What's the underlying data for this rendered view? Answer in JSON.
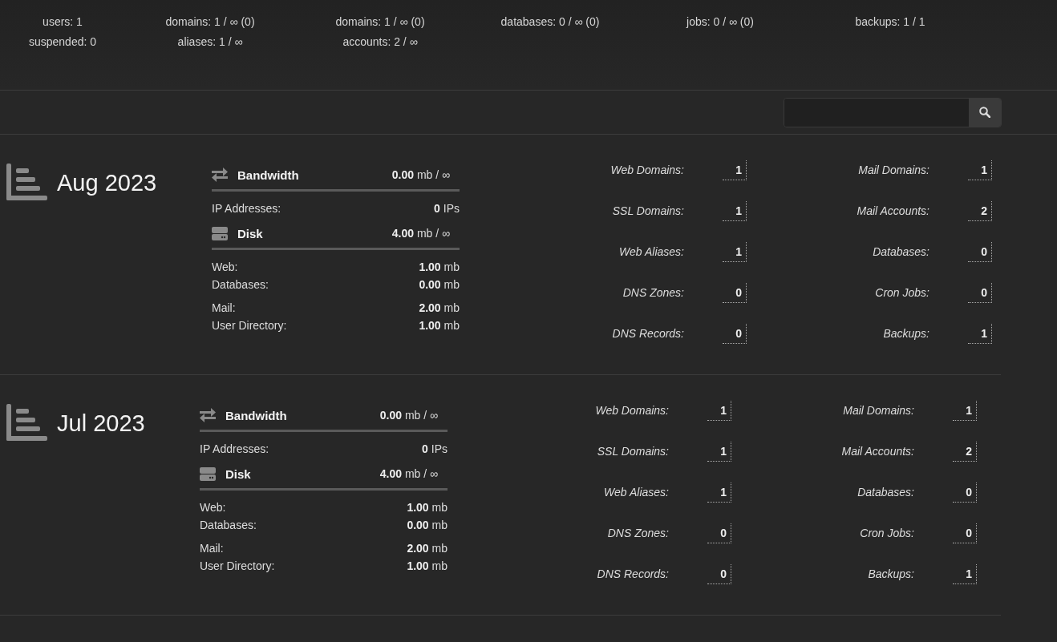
{
  "summary": [
    {
      "lines": [
        "users: 1",
        "suspended: 0"
      ]
    },
    {
      "lines": [
        "domains: 1 / ∞ (0)",
        "aliases: 1 / ∞"
      ]
    },
    {
      "lines": [
        "domains: 1 / ∞ (0)",
        "accounts: 2 / ∞"
      ]
    },
    {
      "lines": [
        "databases: 0 / ∞ (0)"
      ]
    },
    {
      "lines": [
        "jobs: 0 / ∞ (0)"
      ]
    },
    {
      "lines": [
        "backups: 1 / 1"
      ]
    }
  ],
  "months": [
    {
      "title": "Aug 2023",
      "bandwidth": {
        "label": "Bandwidth",
        "value": "**0.00** mb / ∞"
      },
      "ip": {
        "label": "IP Addresses:",
        "value": "**0** IPs"
      },
      "disk": {
        "label": "Disk",
        "value": "**4.00** mb / ∞"
      },
      "disk_items": [
        {
          "label": "Web:",
          "value": "**1.00** mb"
        },
        {
          "label": "Databases:",
          "value": "**0.00** mb"
        },
        {
          "label": "Mail:",
          "value": "**2.00** mb"
        },
        {
          "label": "User Directory:",
          "value": "**1.00** mb"
        }
      ],
      "stats_left": [
        {
          "label": "Web Domains:",
          "value": "1"
        },
        {
          "label": "SSL Domains:",
          "value": "1"
        },
        {
          "label": "Web Aliases:",
          "value": "1"
        },
        {
          "label": "DNS Zones:",
          "value": "0"
        },
        {
          "label": "DNS Records:",
          "value": "0"
        }
      ],
      "stats_right": [
        {
          "label": "Mail Domains:",
          "value": "1"
        },
        {
          "label": "Mail Accounts:",
          "value": "2"
        },
        {
          "label": "Databases:",
          "value": "0"
        },
        {
          "label": "Cron Jobs:",
          "value": "0"
        },
        {
          "label": "Backups:",
          "value": "1"
        }
      ]
    },
    {
      "title": "Jul 2023",
      "bandwidth": {
        "label": "Bandwidth",
        "value": "**0.00** mb / ∞"
      },
      "ip": {
        "label": "IP Addresses:",
        "value": "**0** IPs"
      },
      "disk": {
        "label": "Disk",
        "value": "**4.00** mb / ∞"
      },
      "disk_items": [
        {
          "label": "Web:",
          "value": "**1.00** mb"
        },
        {
          "label": "Databases:",
          "value": "**0.00** mb"
        },
        {
          "label": "Mail:",
          "value": "**2.00** mb"
        },
        {
          "label": "User Directory:",
          "value": "**1.00** mb"
        }
      ],
      "stats_left": [
        {
          "label": "Web Domains:",
          "value": "1"
        },
        {
          "label": "SSL Domains:",
          "value": "1"
        },
        {
          "label": "Web Aliases:",
          "value": "1"
        },
        {
          "label": "DNS Zones:",
          "value": "0"
        },
        {
          "label": "DNS Records:",
          "value": "0"
        }
      ],
      "stats_right": [
        {
          "label": "Mail Domains:",
          "value": "1"
        },
        {
          "label": "Mail Accounts:",
          "value": "2"
        },
        {
          "label": "Databases:",
          "value": "0"
        },
        {
          "label": "Cron Jobs:",
          "value": "0"
        },
        {
          "label": "Backups:",
          "value": "1"
        }
      ]
    }
  ]
}
